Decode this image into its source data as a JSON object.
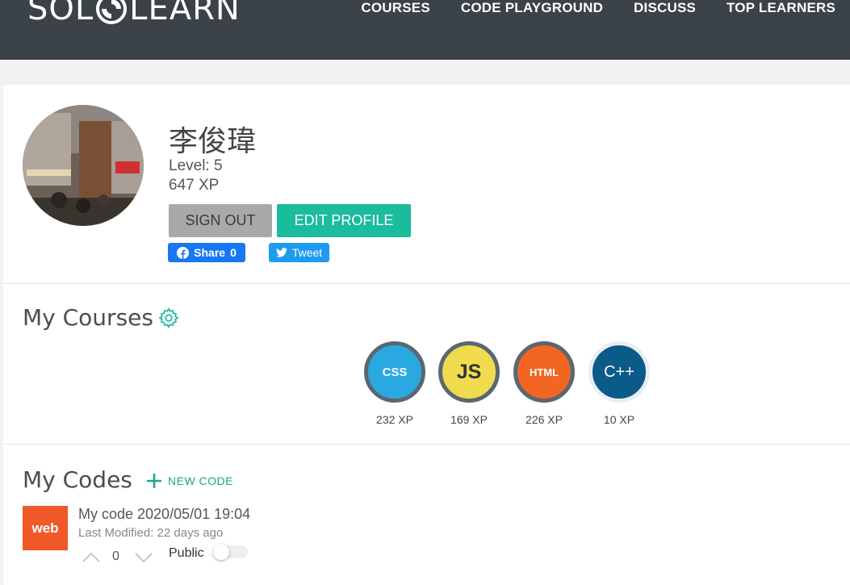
{
  "header": {
    "logo_text_left": "SOL",
    "logo_text_right": "LEARN",
    "nav": [
      {
        "label": "COURSES"
      },
      {
        "label": "CODE PLAYGROUND"
      },
      {
        "label": "DISCUSS"
      },
      {
        "label": "TOP LEARNERS"
      }
    ]
  },
  "profile": {
    "name": "李俊瑋",
    "level": "Level: 5",
    "xp": "647 XP",
    "sign_out_label": "SIGN OUT",
    "edit_profile_label": "EDIT PROFILE",
    "share_label": "Share",
    "share_count": "0",
    "tweet_label": "Tweet"
  },
  "courses": {
    "title": "My Courses",
    "items": [
      {
        "label": "CSS",
        "xp": "232 XP",
        "color": "#29a9e0",
        "text_color": "#ffffff",
        "icon": "css-course-icon"
      },
      {
        "label": "JS",
        "xp": "169 XP",
        "color": "#f0db4f",
        "text_color": "#323330",
        "icon": "js-course-icon"
      },
      {
        "label": "HTML",
        "xp": "226 XP",
        "color": "#f26522",
        "text_color": "#ffffff",
        "icon": "html-course-icon"
      },
      {
        "label": "C++",
        "xp": "10 XP",
        "color": "#0a5a8a",
        "text_color": "#ffffff",
        "icon": "cpp-course-icon"
      }
    ]
  },
  "codes": {
    "title": "My Codes",
    "new_code_label": "NEW CODE",
    "items": [
      {
        "badge": "web",
        "title": "My code 2020/05/01 19:04",
        "modified": "Last Modified: 22 days ago",
        "votes": "0",
        "visibility_label": "Public",
        "public": false
      }
    ]
  },
  "colors": {
    "topbar": "#3b4248",
    "accent": "#1abc9c",
    "facebook": "#1877f2",
    "twitter": "#1d9bf0"
  }
}
